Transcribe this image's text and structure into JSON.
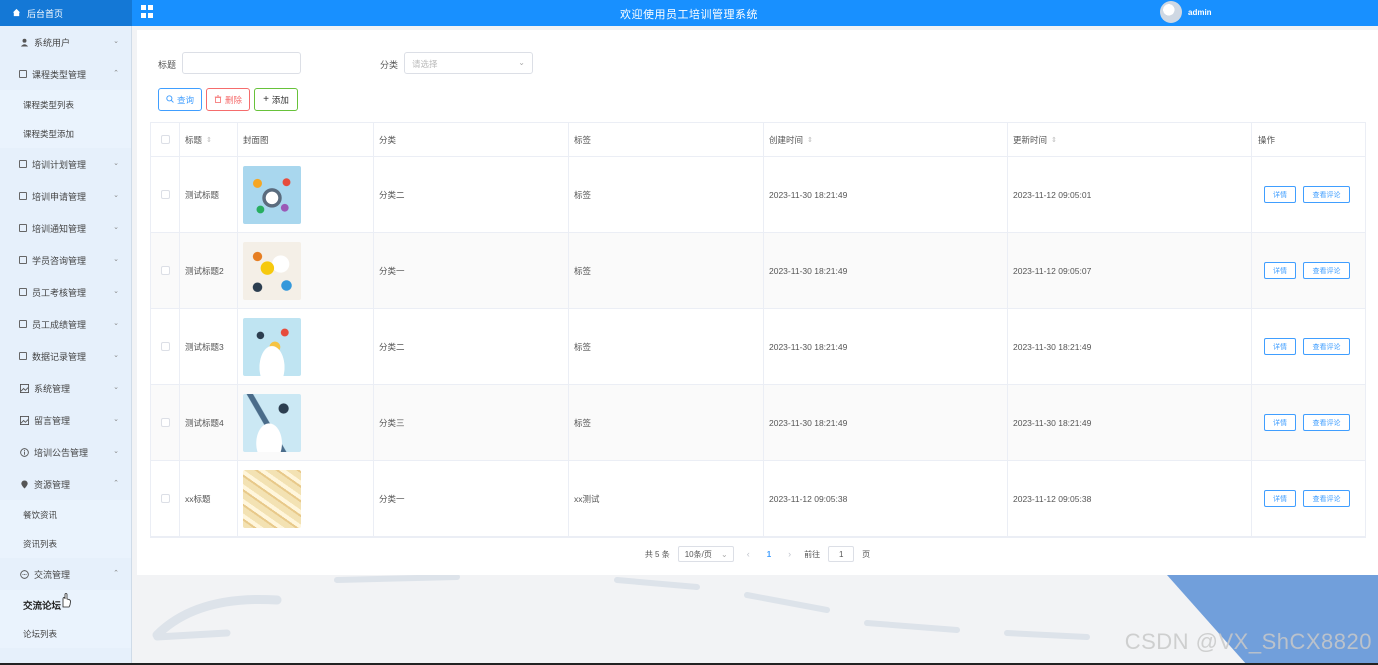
{
  "topbar": {
    "home_label": "后台首页",
    "system_title": "欢迎使用员工培训管理系统",
    "username": "admin",
    "bg_color": "#1890ff"
  },
  "sidebar": {
    "items": [
      {
        "label": "系统用户",
        "icon": "user-icon",
        "expanded": false
      },
      {
        "label": "课程类型管理",
        "icon": "folder-icon",
        "expanded": true,
        "children": [
          "课程类型列表",
          "课程类型添加"
        ]
      },
      {
        "label": "培训计划管理",
        "icon": "folder-icon",
        "expanded": false
      },
      {
        "label": "培训申请管理",
        "icon": "folder-icon",
        "expanded": false
      },
      {
        "label": "培训通知管理",
        "icon": "folder-icon",
        "expanded": false
      },
      {
        "label": "学员咨询管理",
        "icon": "folder-icon",
        "expanded": false
      },
      {
        "label": "员工考核管理",
        "icon": "folder-icon",
        "expanded": false
      },
      {
        "label": "员工成绩管理",
        "icon": "folder-icon",
        "expanded": false
      },
      {
        "label": "数据记录管理",
        "icon": "folder-icon",
        "expanded": false
      },
      {
        "label": "系统管理",
        "icon": "picture-icon",
        "expanded": false
      },
      {
        "label": "留言管理",
        "icon": "picture-icon",
        "expanded": false
      },
      {
        "label": "培训公告管理",
        "icon": "info-icon",
        "expanded": false
      },
      {
        "label": "资源管理",
        "icon": "location-icon",
        "expanded": true,
        "children": [
          "餐饮资讯",
          "资讯列表"
        ]
      },
      {
        "label": "交流管理",
        "icon": "chat-icon",
        "expanded": true,
        "children": [
          "交流论坛",
          "论坛列表"
        ]
      }
    ]
  },
  "filters": {
    "title_label": "标题",
    "title_value": "",
    "category_label": "分类",
    "category_placeholder": "请选择"
  },
  "actions": {
    "query": "查询",
    "delete": "删除",
    "add": "添加"
  },
  "table": {
    "headers": {
      "title": "标题",
      "cover": "封面图",
      "category": "分类",
      "tag": "标签",
      "created": "创建时间",
      "updated": "更新时间",
      "ops": "操作"
    },
    "rows": [
      {
        "title": "测试标题",
        "category": "分类二",
        "tag": "标签",
        "created": "2023-11-30 18:21:49",
        "updated": "2023-11-12 09:05:01",
        "detail": "详情",
        "comment": "查看评论"
      },
      {
        "title": "测试标题2",
        "category": "分类一",
        "tag": "标签",
        "created": "2023-11-30 18:21:49",
        "updated": "2023-11-12 09:05:07",
        "detail": "详情",
        "comment": "查看评论"
      },
      {
        "title": "测试标题3",
        "category": "分类二",
        "tag": "标签",
        "created": "2023-11-30 18:21:49",
        "updated": "2023-11-30 18:21:49",
        "detail": "详情",
        "comment": "查看评论"
      },
      {
        "title": "测试标题4",
        "category": "分类三",
        "tag": "标签",
        "created": "2023-11-30 18:21:49",
        "updated": "2023-11-30 18:21:49",
        "detail": "详情",
        "comment": "查看评论"
      },
      {
        "title": "xx标题",
        "category": "分类一",
        "tag": "xx测试",
        "created": "2023-11-12 09:05:38",
        "updated": "2023-11-12 09:05:38",
        "detail": "详情",
        "comment": "查看评论"
      }
    ]
  },
  "pagination": {
    "total_text": "共 5 条",
    "page_size": "10条/页",
    "current_page": "1",
    "goto_label": "前往",
    "goto_value": "1",
    "page_suffix": "页"
  },
  "watermark": "CSDN @VX_ShCX8820"
}
